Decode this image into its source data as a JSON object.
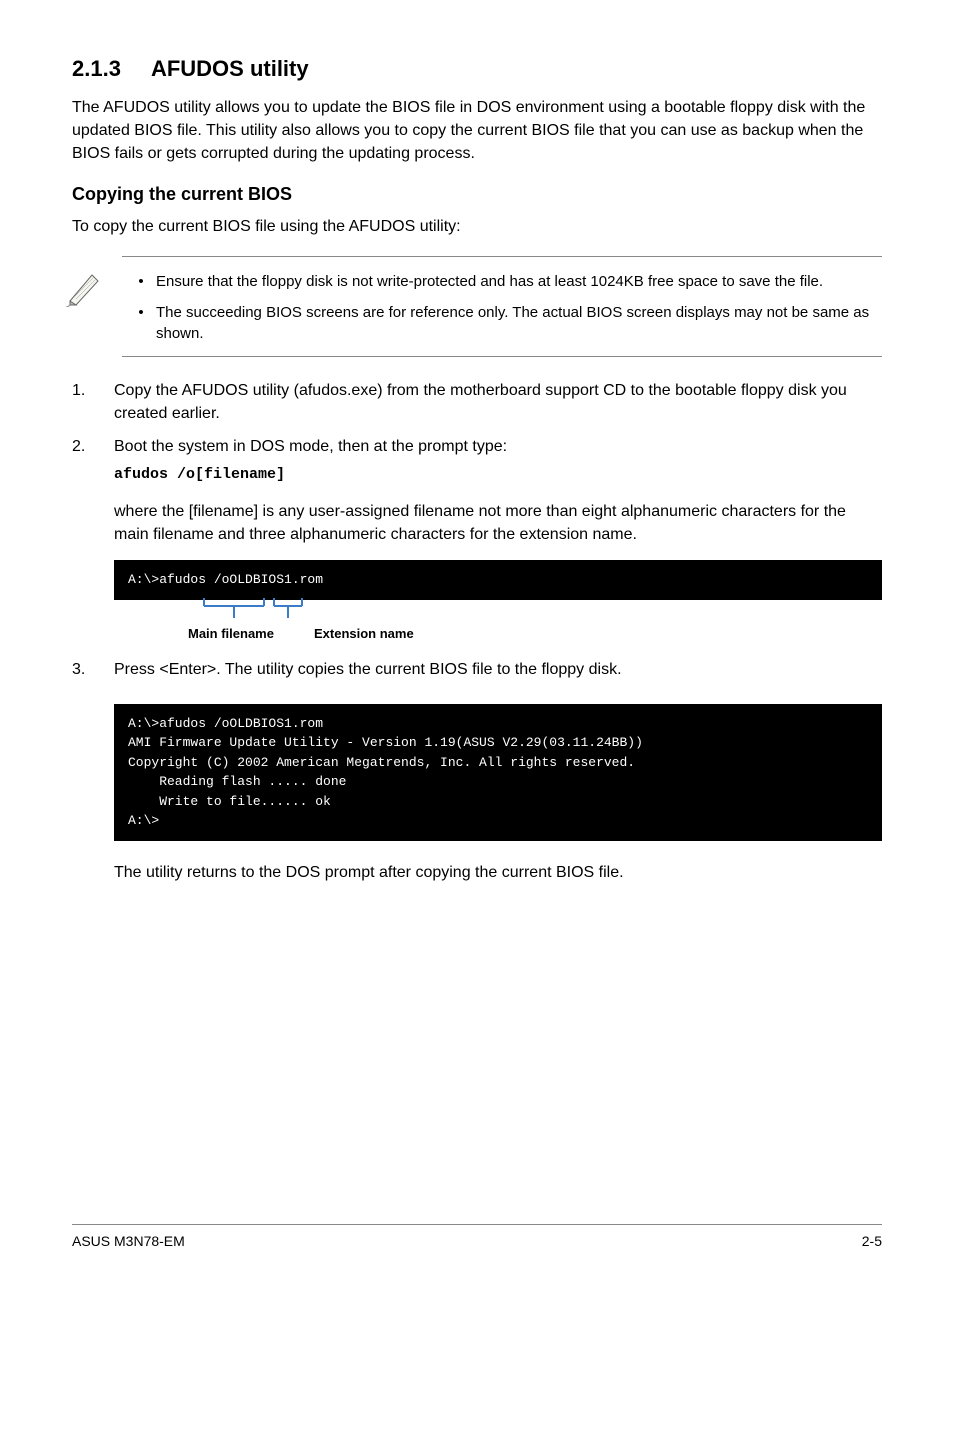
{
  "section": {
    "number": "2.1.3",
    "title": "AFUDOS utility"
  },
  "intro": "The AFUDOS utility allows you to update the BIOS file in DOS environment using a bootable floppy disk with the updated BIOS file. This utility also allows you to copy the current BIOS file that you can use as backup when the BIOS fails or gets corrupted during the updating process.",
  "sub1_title": "Copying the current BIOS",
  "sub1_lead": "To copy the current BIOS file using the AFUDOS utility:",
  "notes": [
    "Ensure that the floppy disk is not write-protected and has at least 1024KB free space to save the file.",
    "The succeeding BIOS screens are for reference only. The actual BIOS screen displays may not be same as shown."
  ],
  "steps": [
    {
      "n": "1.",
      "text": "Copy the AFUDOS utility (afudos.exe) from the motherboard support CD to the bootable floppy disk you created earlier."
    },
    {
      "n": "2.",
      "text": "Boot the system in DOS mode, then at the prompt type:",
      "code": "afudos /o[filename]"
    }
  ],
  "where_para": "where the [filename] is any user-assigned filename not more than eight alphanumeric characters  for the main filename and three alphanumeric characters for the extension name.",
  "terminal1": "A:\\>afudos /oOLDBIOS1.rom",
  "fn_labels": {
    "main": "Main filename",
    "ext": "Extension name"
  },
  "step3": {
    "n": "3.",
    "text": "Press <Enter>. The utility copies the current BIOS file to the floppy disk."
  },
  "terminal2": "A:\\>afudos /oOLDBIOS1.rom\nAMI Firmware Update Utility - Version 1.19(ASUS V2.29(03.11.24BB))\nCopyright (C) 2002 American Megatrends, Inc. All rights reserved.\n    Reading flash ..... done\n    Write to file...... ok\nA:\\>",
  "post_para": "The utility returns to the DOS prompt after copying the current BIOS file.",
  "footer": {
    "left": "ASUS M3N78-EM",
    "right": "2-5"
  }
}
